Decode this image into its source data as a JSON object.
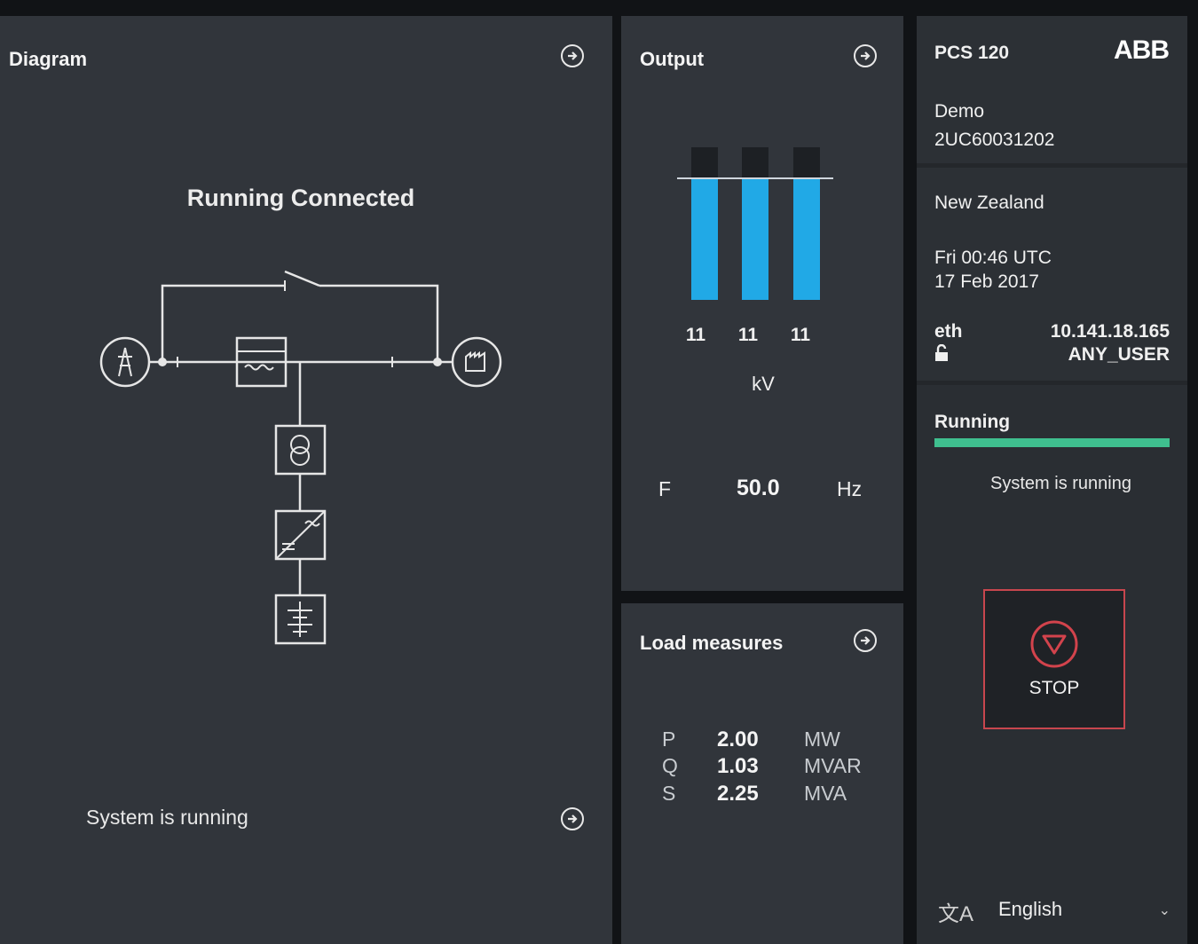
{
  "diagram": {
    "title": "Diagram",
    "state": "Running Connected",
    "footer_status": "System is running"
  },
  "output": {
    "title": "Output",
    "bars": [
      {
        "value": "11",
        "level": 0.8
      },
      {
        "value": "11",
        "level": 0.8
      },
      {
        "value": "11",
        "level": 0.8
      }
    ],
    "voltage_unit": "kV",
    "freq_label": "F",
    "freq_value": "50.0",
    "freq_unit": "Hz"
  },
  "load": {
    "title": "Load measures",
    "rows": [
      {
        "label": "P",
        "value": "2.00",
        "unit": "MW"
      },
      {
        "label": "Q",
        "value": "1.03",
        "unit": "MVAR"
      },
      {
        "label": "S",
        "value": "2.25",
        "unit": "MVA"
      }
    ]
  },
  "info": {
    "product": "PCS 120",
    "brand": "ABB",
    "site_name": "Demo",
    "serial": "2UC60031202",
    "location": "New Zealand",
    "datetime_line1": "Fri 00:46 UTC",
    "datetime_line2": "17 Feb 2017",
    "net_iface": "eth",
    "ip": "10.141.18.165",
    "user": "ANY_USER",
    "state": "Running",
    "state_message": "System is running",
    "stop_label": "STOP",
    "language": "English"
  },
  "colors": {
    "accent_blue": "#21a9e6",
    "running_green": "#3fbf8f",
    "stop_red": "#c7464e",
    "panel_bg": "#31353b"
  },
  "icons": {
    "nav": "arrow-circle-right-icon",
    "lock": "unlocked-padlock-icon",
    "stop": "triangle-down-circle-icon",
    "language": "translate-icon",
    "dropdown": "chevron-down-icon"
  }
}
